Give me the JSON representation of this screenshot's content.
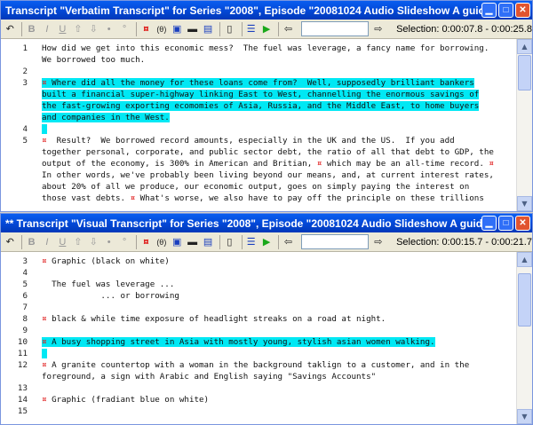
{
  "windows": [
    {
      "title": "Transcript \"Verbatim Transcript\" for Series \"2008\", Episode \"20081024 Audio Slideshow A guide to the credit crunch\"",
      "selection_label": "Selection:",
      "selection_value": "0:00:07.8 - 0:00:25.8",
      "lines": [
        {
          "num": "1",
          "text": "How did we get into this economic mess?  The fuel was leverage, a fancy name for borrowing.",
          "hl": false,
          "mark": false
        },
        {
          "num": "",
          "text": "We borrowed too much.",
          "hl": false,
          "mark": false
        },
        {
          "num": "2",
          "text": "",
          "hl": false,
          "mark": false
        },
        {
          "num": "3",
          "text": " Where did all the money for these loans come from?  Well, supposedly brilliant bankers",
          "hl": true,
          "mark": true
        },
        {
          "num": "",
          "text": "built a financial super-highway linking East to West, channelling the enormous savings of",
          "hl": true,
          "mark": false
        },
        {
          "num": "",
          "text": "the fast-growing exporting ecomomies of Asia, Russia, and the Middle East, to home buyers",
          "hl": true,
          "mark": false
        },
        {
          "num": "",
          "text": "and companies in the West.",
          "hl": true,
          "mark": false
        },
        {
          "num": "4",
          "text": " ",
          "hl": true,
          "mark": false
        },
        {
          "num": "5",
          "text": "  Result?  We borrowed record amounts, especially in the UK and the US.  If you add",
          "hl": false,
          "mark": true
        },
        {
          "num": "",
          "text": "together personal, corporate, and public sector debt, the ratio of all that debt to GDP, the",
          "hl": false,
          "mark": false
        },
        {
          "num": "",
          "text": "output of the economy, is 300% in American and Britian, ¤ which may be an all-time record. ¤",
          "hl": false,
          "mark": false
        },
        {
          "num": "",
          "text": "In other words, we've probably been living beyond our means, and, at current interest rates,",
          "hl": false,
          "mark": false
        },
        {
          "num": "",
          "text": "about 20% of all we produce, our economic output, goes on simply paying the interest on",
          "hl": false,
          "mark": false
        },
        {
          "num": "",
          "text": "those vast debts. ¤ What's worse, we also have to pay off the principle on these trillions",
          "hl": false,
          "mark": false
        }
      ]
    },
    {
      "title": "** Transcript \"Visual Transcript\" for Series \"2008\", Episode \"20081024 Audio Slideshow A guide to the credit crunch\" **",
      "selection_label": "Selection:",
      "selection_value": "0:00:15.7 - 0:00:21.7",
      "lines": [
        {
          "num": "3",
          "text": " Graphic (black on white)",
          "hl": false,
          "mark": true
        },
        {
          "num": "4",
          "text": "",
          "hl": false,
          "mark": false
        },
        {
          "num": "5",
          "text": "  The fuel was leverage ...",
          "hl": false,
          "mark": false
        },
        {
          "num": "6",
          "text": "            ... or borrowing",
          "hl": false,
          "mark": false
        },
        {
          "num": "7",
          "text": "",
          "hl": false,
          "mark": false
        },
        {
          "num": "8",
          "text": " black & while time exposure of headlight streaks on a road at night.",
          "hl": false,
          "mark": true
        },
        {
          "num": "9",
          "text": "",
          "hl": false,
          "mark": false
        },
        {
          "num": "10",
          "text": " A busy shopping street in Asia with mostly young, stylish asian women walking.",
          "hl": true,
          "mark": true
        },
        {
          "num": "11",
          "text": " ",
          "hl": true,
          "mark": false
        },
        {
          "num": "12",
          "text": " A granite countertop with a woman in the background taklign to a customer, and in the",
          "hl": false,
          "mark": true
        },
        {
          "num": "",
          "text": "foreground, a sign with Arabic and English saying \"Savings Accounts\"",
          "hl": false,
          "mark": false
        },
        {
          "num": "13",
          "text": "",
          "hl": false,
          "mark": false
        },
        {
          "num": "14",
          "text": " Graphic (fradiant blue on white)",
          "hl": false,
          "mark": true
        },
        {
          "num": "15",
          "text": "",
          "hl": false,
          "mark": false
        }
      ]
    }
  ],
  "mark_glyph": "¤",
  "toolbar": {
    "bold": "B",
    "italic": "I",
    "underline": "U",
    "prev": "⇧",
    "next": "⇩",
    "bullet": "•",
    "circle": "°",
    "clip": "(θ)",
    "play": "▶",
    "back": "⇦",
    "forward": "⇨"
  },
  "icons": {
    "undo": "undo-icon",
    "minimize": "minimize-icon",
    "maximize": "maximize-icon",
    "close": "close-icon"
  },
  "colors": {
    "highlight": "#00e8f4",
    "mark": "#e02020",
    "titlebar": "#0349d8"
  }
}
